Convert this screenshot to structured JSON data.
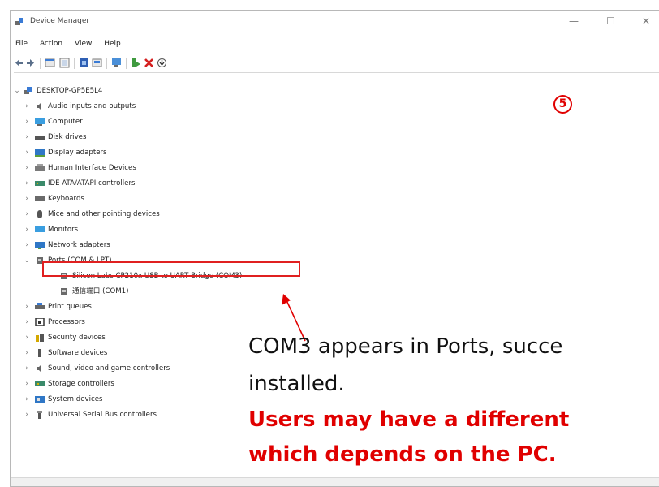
{
  "window": {
    "title": "Device Manager",
    "controls": [
      "—",
      "☐",
      "✕"
    ]
  },
  "menu": [
    "File",
    "Action",
    "View",
    "Help"
  ],
  "tree": {
    "root": "DESKTOP-GP5E5L4",
    "items": [
      {
        "label": "Audio inputs and outputs",
        "icon": "speaker-icon",
        "expanded": false
      },
      {
        "label": "Computer",
        "icon": "computer-icon",
        "expanded": false
      },
      {
        "label": "Disk drives",
        "icon": "disk-icon",
        "expanded": false
      },
      {
        "label": "Display adapters",
        "icon": "display-icon",
        "expanded": false
      },
      {
        "label": "Human Interface Devices",
        "icon": "hid-icon",
        "expanded": false
      },
      {
        "label": "IDE ATA/ATAPI controllers",
        "icon": "ide-icon",
        "expanded": false
      },
      {
        "label": "Keyboards",
        "icon": "keyboard-icon",
        "expanded": false
      },
      {
        "label": "Mice and other pointing devices",
        "icon": "mouse-icon",
        "expanded": false
      },
      {
        "label": "Monitors",
        "icon": "monitor-icon",
        "expanded": false
      },
      {
        "label": "Network adapters",
        "icon": "network-icon",
        "expanded": false
      },
      {
        "label": "Ports (COM & LPT)",
        "icon": "port-icon",
        "expanded": true,
        "children": [
          "Silicon Labs CP210x USB to UART Bridge (COM3)",
          "通信端口 (COM1)"
        ]
      },
      {
        "label": "Print queues",
        "icon": "printer-icon",
        "expanded": false
      },
      {
        "label": "Processors",
        "icon": "processor-icon",
        "expanded": false
      },
      {
        "label": "Security devices",
        "icon": "security-icon",
        "expanded": false
      },
      {
        "label": "Software devices",
        "icon": "software-icon",
        "expanded": false
      },
      {
        "label": "Sound, video and game controllers",
        "icon": "sound-icon",
        "expanded": false
      },
      {
        "label": "Storage controllers",
        "icon": "storage-icon",
        "expanded": false
      },
      {
        "label": "System devices",
        "icon": "system-icon",
        "expanded": false
      },
      {
        "label": "Universal Serial Bus controllers",
        "icon": "usb-icon",
        "expanded": false
      }
    ]
  },
  "annotation": {
    "step": "5",
    "line1": "COM3 appears in Ports, succe",
    "line2": "installed.",
    "line3": "Users may have a different",
    "line4": "which depends on the PC."
  },
  "colors": {
    "accent": "#e00000"
  }
}
